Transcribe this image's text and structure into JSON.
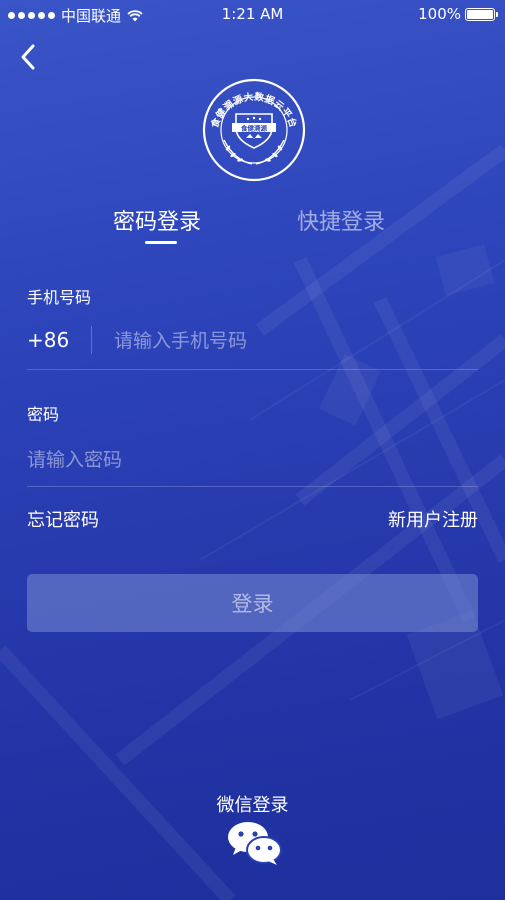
{
  "status_bar": {
    "carrier": "中国联通",
    "time": "1:21 AM",
    "battery_percent": "100%",
    "battery_level": 1.0,
    "signal_dots": 5
  },
  "logo": {
    "ring_text": "食健溯源大数据云平台",
    "banner_text": "食健溯源"
  },
  "tabs": [
    {
      "label": "密码登录",
      "active": true
    },
    {
      "label": "快捷登录",
      "active": false
    }
  ],
  "form": {
    "phone_label": "手机号码",
    "country_code": "+86",
    "phone_placeholder": "请输入手机号码",
    "phone_value": "",
    "password_label": "密码",
    "password_placeholder": "请输入密码",
    "password_value": ""
  },
  "links": {
    "forgot_password": "忘记密码",
    "register": "新用户注册"
  },
  "login_button": "登录",
  "wechat": {
    "label": "微信登录",
    "icon": "wechat-icon"
  },
  "colors": {
    "background_top": "#3a55c8",
    "background_bottom": "#1d2f9c",
    "text": "#ffffff",
    "button_bg": "#7c8cd2"
  }
}
